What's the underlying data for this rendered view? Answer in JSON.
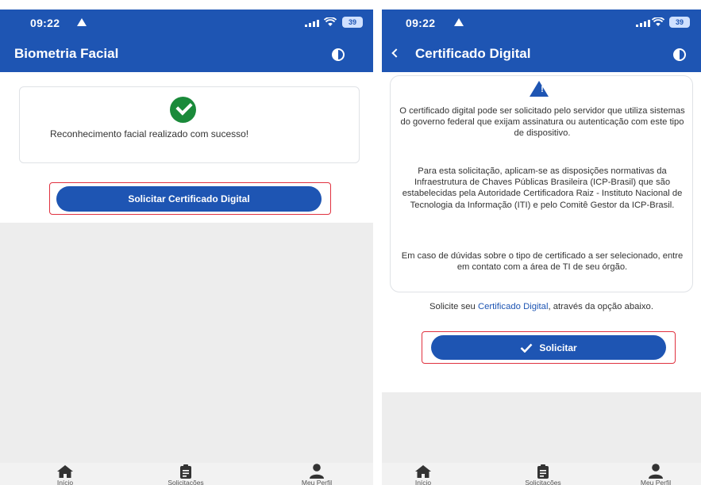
{
  "left_screen": {
    "status": {
      "time": "09:22",
      "battery": "39"
    },
    "title": "Biometria Facial",
    "success_message": "Reconhecimento facial realizado com sucesso!",
    "request_button": "Solicitar Certificado Digital",
    "nav": [
      "Início",
      "Solicitações",
      "Meu Perfil"
    ]
  },
  "right_screen": {
    "status": {
      "time": "09:22",
      "battery": "39"
    },
    "title": "Certificado Digital",
    "paragraph_1": "O certificado digital pode ser solicitado pelo servidor que utiliza sistemas do governo federal que exijam assinatura ou autenticação com este tipo de dispositivo.",
    "paragraph_2": "Para esta solicitação, aplicam-se as disposições normativas da Infraestrutura de Chaves Públicas Brasileira (ICP-Brasil) que são estabelecidas pela Autoridade Certificadora Raiz - Instituto Nacional de Tecnologia da Informação (ITI) e pelo Comitê Gestor da ICP-Brasil.",
    "paragraph_3": "Em caso de dúvidas sobre o tipo de certificado a ser selecionado, entre em contato com a área de TI de seu órgão.",
    "solicite_prefix": "Solicite seu ",
    "solicite_link": "Certificado Digital",
    "solicite_suffix": ", através da opção abaixo.",
    "request_button": "Solicitar",
    "nav": [
      "Início",
      "Solicitações",
      "Meu Perfil"
    ]
  },
  "colors": {
    "brand": "#1e55b3",
    "success": "#1a8a3a",
    "highlight": "#e0313f"
  },
  "icons": [
    "nav-arrow-icon",
    "signal-icon",
    "wifi-icon",
    "battery-icon",
    "theme-toggle-icon",
    "back-icon",
    "check-circle-icon",
    "warning-icon",
    "checkmark-icon",
    "home-icon",
    "clipboard-icon",
    "user-icon"
  ]
}
